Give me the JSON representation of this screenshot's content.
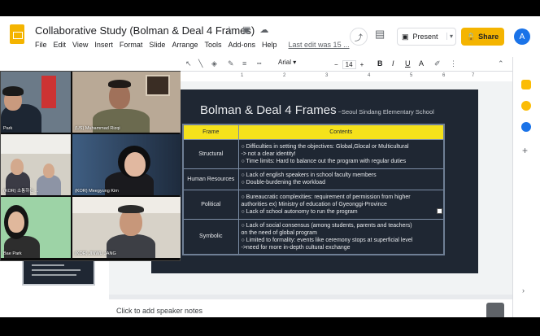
{
  "app": {
    "title": "Collaborative Study (Bolman & Deal 4 Frames)",
    "title_icons": "☆ ▣ ☁",
    "menu": [
      "File",
      "Edit",
      "View",
      "Insert",
      "Format",
      "Slide",
      "Arrange",
      "Tools",
      "Add-ons",
      "Help"
    ],
    "last_edit": "Last edit was 15 ...",
    "present_label": "Present",
    "share_label": "Share",
    "share_icon": "lock-icon",
    "avatar_letter": "A"
  },
  "toolbar": {
    "font": "Arial",
    "font_size": "14",
    "icons": [
      "cursor-icon",
      "line-icon",
      "fill-icon",
      "border-color-icon",
      "border-weight-icon",
      "border-dash-icon",
      "bold-icon",
      "italic-icon",
      "underline-icon",
      "text-color-icon",
      "highlight-icon",
      "collapse-icon"
    ]
  },
  "ruler": {
    "marks": [
      "1",
      "2",
      "3",
      "4",
      "5",
      "6",
      "7"
    ]
  },
  "slide": {
    "title": "Bolman & Deal 4 Frames",
    "subtitle": "~Seoul Sindang Elementary School",
    "table": {
      "headers": [
        "Frame",
        "Contents"
      ],
      "rows": [
        {
          "frame": "Structural",
          "lines": [
            "○ Difficulties in setting the objectives: Global,Glocal or Multicultural",
            "-> not a clear identity!",
            "○ Time limits: Hard to balance out the program with regular duties"
          ]
        },
        {
          "frame": "Human Resources",
          "lines": [
            "○ Lack of english speakers in school faculty members",
            "○ Double-burdening the workload"
          ]
        },
        {
          "frame": "Political",
          "lines": [
            "○ Bureaucratic complexities: requirement of permission from higher",
            "authorities ex) Ministry of education of Gyeonggi-Province",
            "○ Lack of school autonomy to run the program"
          ]
        },
        {
          "frame": "Symbolic",
          "lines": [
            "○ Lack of social consensus (among students, parents and teachers)",
            "on the need of global program",
            "○ Limited to formality: events like ceremony stops at superficial level",
            "->need for more in-depth cultural exchange"
          ]
        }
      ]
    }
  },
  "notes": {
    "placeholder": "Click to add speaker notes"
  },
  "video": {
    "participants": [
      {
        "name": "Park"
      },
      {
        "name": "(US) Muhammad Rizqi"
      },
      {
        "name": "(KOR) 소통하는 ..."
      },
      {
        "name": "(KOR) Meegyung Kim"
      },
      {
        "name": "Bae Park"
      },
      {
        "name": "(KOR) JINWU JANG"
      }
    ]
  },
  "colors": {
    "share": "#f4b400",
    "slide_bg": "#1f2733",
    "header_yellow": "#f5e21b",
    "avatar": "#1a73e8"
  }
}
